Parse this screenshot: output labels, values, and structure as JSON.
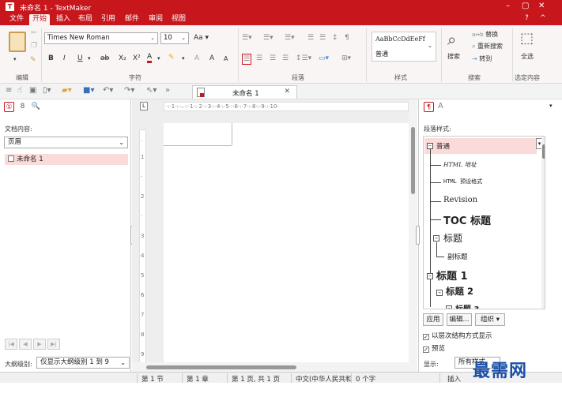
{
  "window": {
    "app_icon": "T",
    "title": "未命名 1 - TextMaker",
    "minimize": "–",
    "maximize": "▢",
    "close": "✕"
  },
  "menu": {
    "tabs": [
      "文件",
      "开始",
      "插入",
      "布局",
      "引用",
      "邮件",
      "审阅",
      "视图"
    ],
    "active_index": 1,
    "help": "?",
    "collapse": "^"
  },
  "ribbon": {
    "groups": [
      "编辑",
      "字符",
      "段落",
      "样式",
      "搜索",
      "选定内容"
    ],
    "font_name": "Times New Roman",
    "font_size": "10",
    "style_preview": "AaBbCcDdEeFf",
    "style_name": "普通",
    "search_label": "搜索",
    "replace_label": "替换",
    "search_again_label": "重新搜索",
    "goto_label": "转到",
    "select_all_label": "全选",
    "char_buttons": [
      "B",
      "I",
      "U",
      "ab",
      "X₂",
      "X²",
      "A",
      "A",
      "A",
      "A"
    ]
  },
  "document_tab": {
    "label": "未命名 1",
    "close": "✕"
  },
  "left_panel": {
    "tabs": [
      "①",
      "8",
      "🔍"
    ],
    "doc_content_label": "文档内容:",
    "view_select": "页眉",
    "items": [
      "未命名 1"
    ],
    "outline_label": "大纲级别:",
    "outline_select": "仅显示大纲级别 1 到 9"
  },
  "ruler": {
    "text": "·:·1·:·⌵·:·1·:·2·:·3·:·4·:·5·:·6·:·7·:·8·:·9·:·10·"
  },
  "right_panel": {
    "title": "段落样式:",
    "styles": [
      {
        "label": "普通",
        "selected": true
      },
      {
        "label": "HTML 地址"
      },
      {
        "label": "HTML 预设格式"
      },
      {
        "label": "Revision"
      },
      {
        "label": "TOC 标题"
      },
      {
        "label": "标题"
      },
      {
        "label": "副标题"
      },
      {
        "label": "标题 1"
      },
      {
        "label": "标题 2"
      },
      {
        "label": "标题 3"
      }
    ],
    "buttons": [
      "应用",
      "编辑...",
      "组织 ▾"
    ],
    "check_hierarchy": "以层次结构方式显示",
    "check_preview": "预览",
    "display_label": "显示:",
    "display_value": "所有样式"
  },
  "statusbar": {
    "section": "第 1 节",
    "chapter": "第 1 章",
    "page": "第 1 页, 共 1 页",
    "language": "中文(中华人民共和",
    "chars": "0 个字",
    "mode": "插入"
  },
  "watermark": "最需网"
}
